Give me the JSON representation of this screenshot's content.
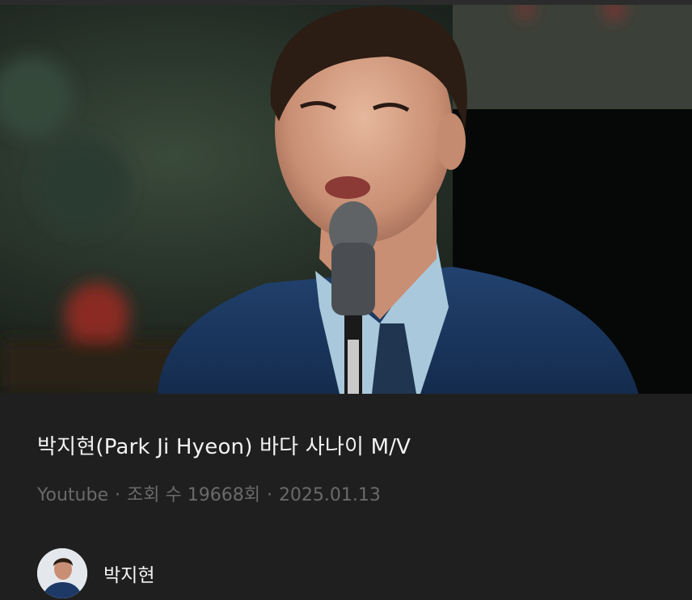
{
  "video": {
    "title": "박지현(Park Ji Hyeon) 바다 사나이 M/V",
    "source": "Youtube",
    "views": "조회 수 19668회",
    "date": "2025.01.13",
    "separator": "·"
  },
  "channel": {
    "name": "박지현"
  },
  "colors": {
    "background": "#1f1f1f",
    "title_text": "#f2f2f2",
    "meta_text": "#6a6a6a",
    "suit": "#1d3a66"
  }
}
